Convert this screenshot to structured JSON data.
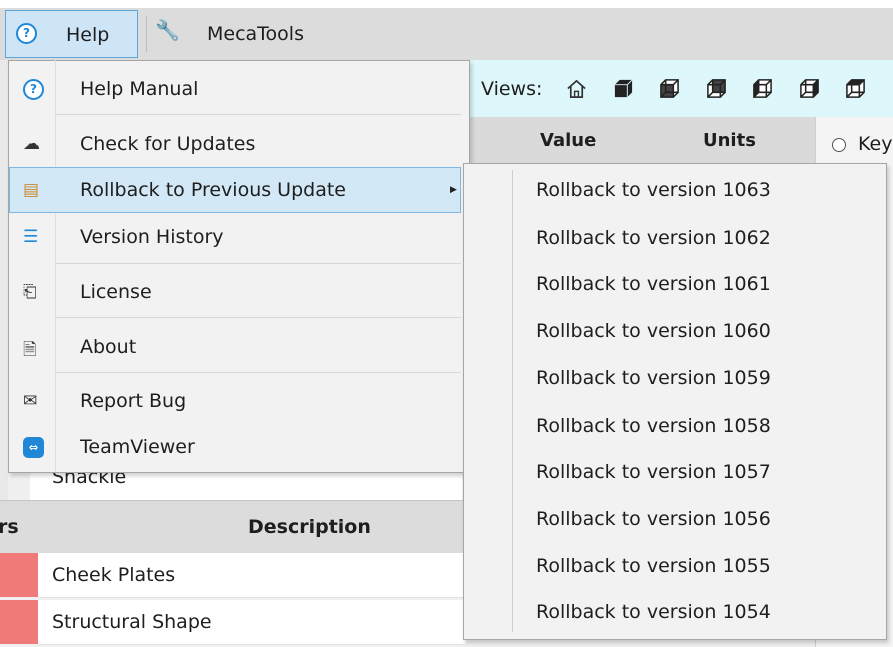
{
  "menubar": {
    "help_label": "Help",
    "mecatools_label": "MecaTools"
  },
  "toolbar": {
    "views_label": "Views:"
  },
  "grid": {
    "value_header": "Value",
    "units_header": "Units",
    "key_label": "Key"
  },
  "lower_panel": {
    "shackle_text": "Shackle",
    "left_header_fragment": "rs",
    "description_header": "Description",
    "rows": [
      "Cheek Plates",
      "Structural Shape"
    ]
  },
  "help_menu": {
    "items": [
      {
        "label": "Help Manual",
        "icon": "help-circle-icon"
      },
      {
        "label": "Check for Updates",
        "icon": "cloud-download-icon"
      },
      {
        "label": "Rollback to Previous Update",
        "icon": "rollback-icon"
      },
      {
        "label": "Version History",
        "icon": "list-icon"
      },
      {
        "label": "License",
        "icon": "license-icon"
      },
      {
        "label": "About",
        "icon": "about-info-icon"
      },
      {
        "label": "Report Bug",
        "icon": "mail-bug-icon"
      },
      {
        "label": "TeamViewer",
        "icon": "teamviewer-icon"
      }
    ]
  },
  "rollback_submenu": {
    "items": [
      "Rollback to version 1063",
      "Rollback to version 1062",
      "Rollback to version 1061",
      "Rollback to version 1060",
      "Rollback to version 1059",
      "Rollback to version 1058",
      "Rollback to version 1057",
      "Rollback to version 1056",
      "Rollback to version 1055",
      "Rollback to version 1054"
    ]
  },
  "colors": {
    "accent": "#1f87d6",
    "highlight": "#d3e8f7",
    "toolbar_bg": "#ddf7fb",
    "row_marker": "#f07a7a"
  }
}
